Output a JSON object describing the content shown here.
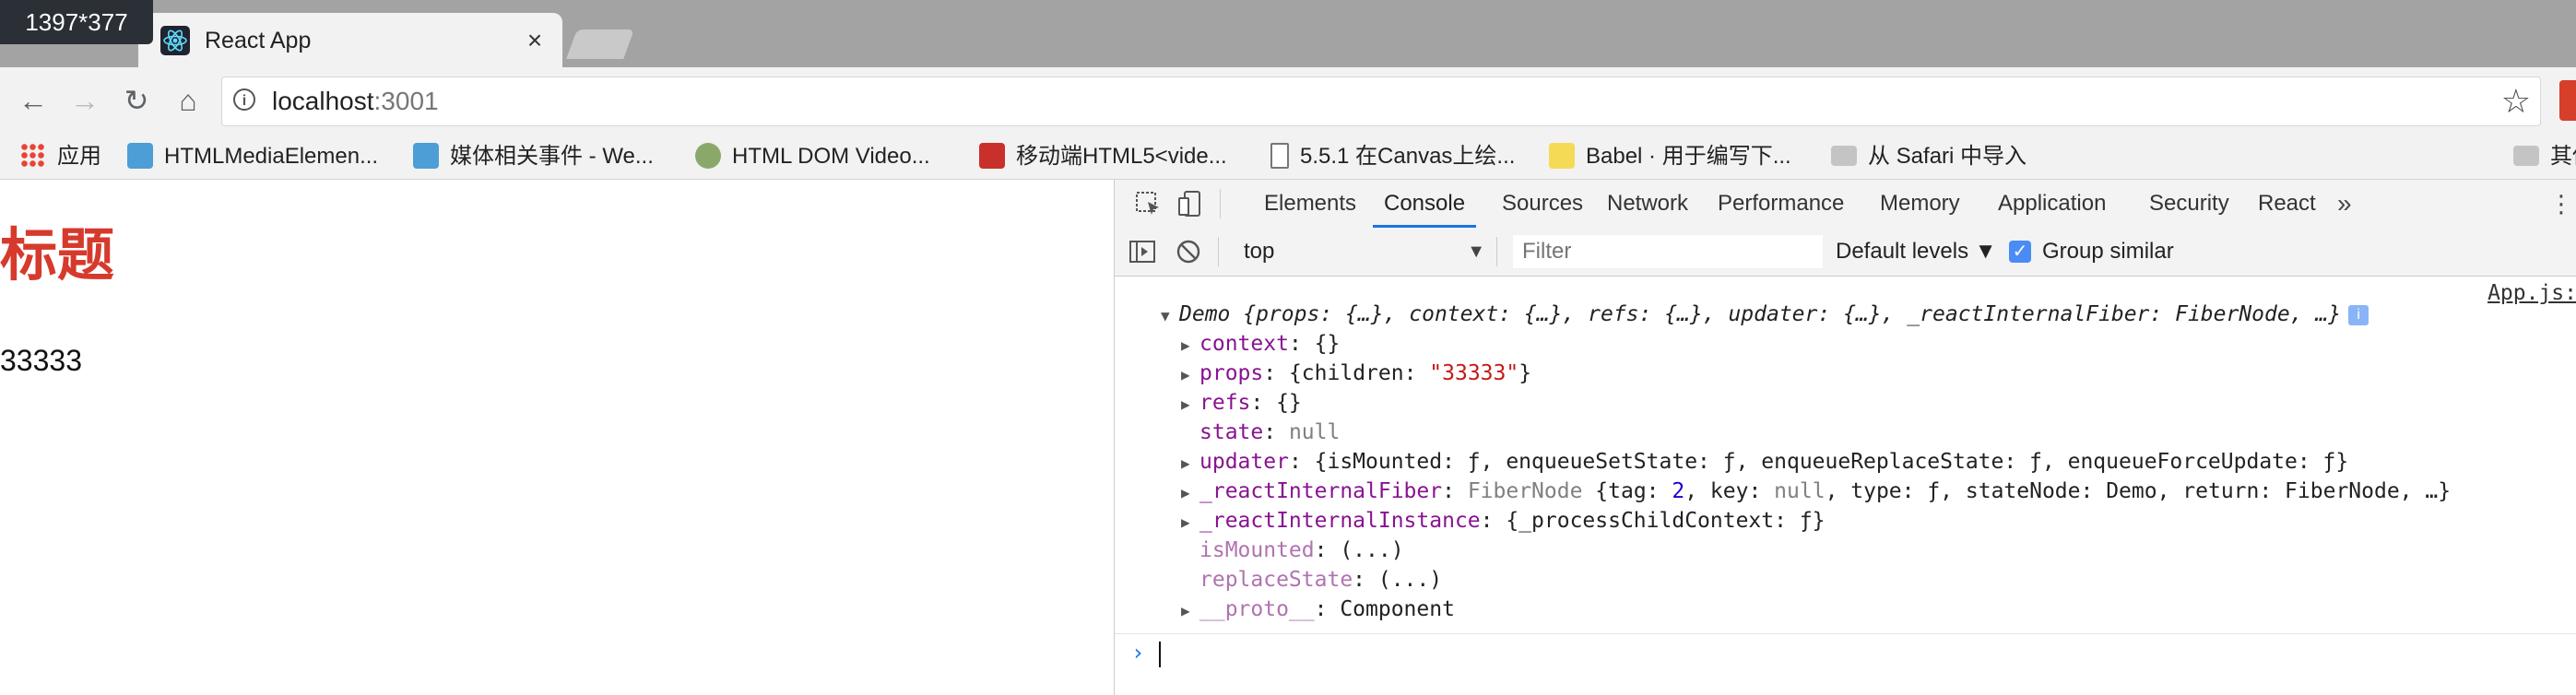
{
  "window": {
    "size_badge": "1397*377",
    "tab_title": "React App",
    "tab_close": "×"
  },
  "toolbar": {
    "back": "←",
    "forward": "→",
    "reload": "↻",
    "home": "⌂",
    "url_host": "localhost",
    "url_port": ":3001",
    "star": "☆"
  },
  "bookmarks": [
    {
      "label": "应用",
      "icon": "apps-grid-icon"
    },
    {
      "label": "HTMLMediaElemen...",
      "icon": "mdn-dino-icon"
    },
    {
      "label": "媒体相关事件 - We...",
      "icon": "mdn-dino-icon"
    },
    {
      "label": "HTML DOM Video...",
      "icon": "w3schools-icon"
    },
    {
      "label": "移动端HTML5<vide...",
      "icon": "csdn-icon"
    },
    {
      "label": "5.5.1 在Canvas上绘...",
      "icon": "page-icon"
    },
    {
      "label": "Babel · 用于编写下...",
      "icon": "babel-icon"
    },
    {
      "label": "从 Safari 中导入",
      "icon": "folder-icon"
    },
    {
      "label": "其他",
      "icon": "folder-icon"
    }
  ],
  "page": {
    "heading": "标题",
    "text": "33333"
  },
  "devtools": {
    "tabs": [
      "Elements",
      "Console",
      "Sources",
      "Network",
      "Performance",
      "Memory",
      "Application",
      "Security",
      "React"
    ],
    "active_tab": "Console",
    "more": "»",
    "kebab": "⋮",
    "context": "top",
    "context_arrow": "▼",
    "filter_placeholder": "Filter",
    "levels": "Default levels ▼",
    "group_check": "✓",
    "group_similar": "Group similar",
    "source_link": "App.js:"
  },
  "console": {
    "header": {
      "prefix": "Demo ",
      "summary": "{props: {…}, context: {…}, refs: {…}, updater: {…}, _reactInternalFiber: ",
      "fiber": "FiberNode",
      "tail": ", …}",
      "badge": "i"
    },
    "props_children_key": "{children: ",
    "props_children_val": "\"33333\"",
    "rows": {
      "context_key": "context",
      "context_val": ": {}",
      "props_key": "props",
      "refs_key": "refs",
      "refs_val": ": {}",
      "state_key": "state",
      "state_val": "null",
      "updater_key": "updater",
      "updater_val": ": {isMounted: ƒ, enqueueSetState: ƒ, enqueueReplaceState: ƒ, enqueueForceUpdate: ƒ}",
      "fiber_key": "_reactInternalFiber",
      "fiber_type": "FiberNode",
      "fiber_open": " {tag: ",
      "fiber_tag": "2",
      "fiber_key_lbl": ", key: ",
      "fiber_key_val": "null",
      "fiber_rest": ", type: ƒ, stateNode: Demo, return: FiberNode, …}",
      "instance_key": "_reactInternalInstance",
      "instance_val": ": {_processChildContext: ƒ}",
      "ismounted_key": "isMounted",
      "ismounted_val": ": (...)",
      "replacestate_key": "replaceState",
      "replacestate_val": ": (...)",
      "proto_key": "__proto__",
      "proto_val": ": Component"
    },
    "prompt": "›"
  }
}
